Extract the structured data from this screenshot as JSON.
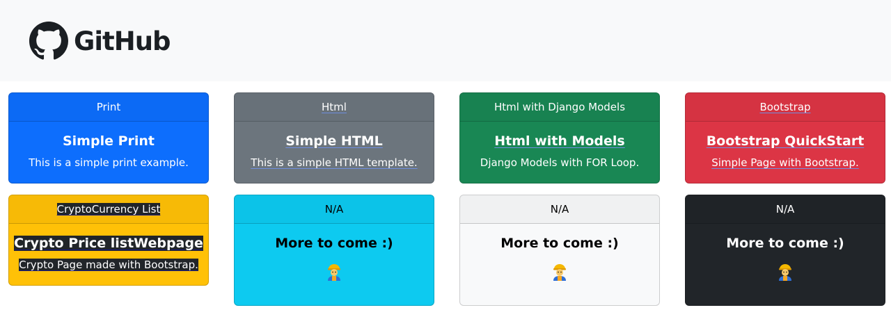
{
  "navbar": {
    "brand": "GitHub"
  },
  "cards": [
    {
      "header": "Print",
      "title": "Simple Print",
      "text": "This is a simple print example."
    },
    {
      "header": "Html",
      "title": "Simple HTML",
      "text": "This is a simple HTML template."
    },
    {
      "header": "Html with Django Models",
      "title": "Html with Models",
      "text": "Django Models with FOR Loop."
    },
    {
      "header": "Bootstrap",
      "title": "Bootstrap QuickStart",
      "text": "Simple Page with Bootstrap."
    },
    {
      "header": "CryptoCurrency List",
      "title": "Crypto Price listWebpage",
      "text": "Crypto Page made with Bootstrap."
    },
    {
      "header": "N/A",
      "title": "More to come :)",
      "icon": "construction-worker-icon"
    },
    {
      "header": "N/A",
      "title": "More to come :)",
      "icon": "construction-worker-icon"
    },
    {
      "header": "N/A",
      "title": "More to come :)",
      "icon": "construction-worker-icon"
    }
  ],
  "colors": {
    "primary": "#0d6efd",
    "secondary": "#6c757d",
    "success": "#198754",
    "danger": "#dc3545",
    "warning": "#ffc107",
    "info": "#0dcaf0",
    "light": "#f8f9fa",
    "dark": "#212529"
  }
}
